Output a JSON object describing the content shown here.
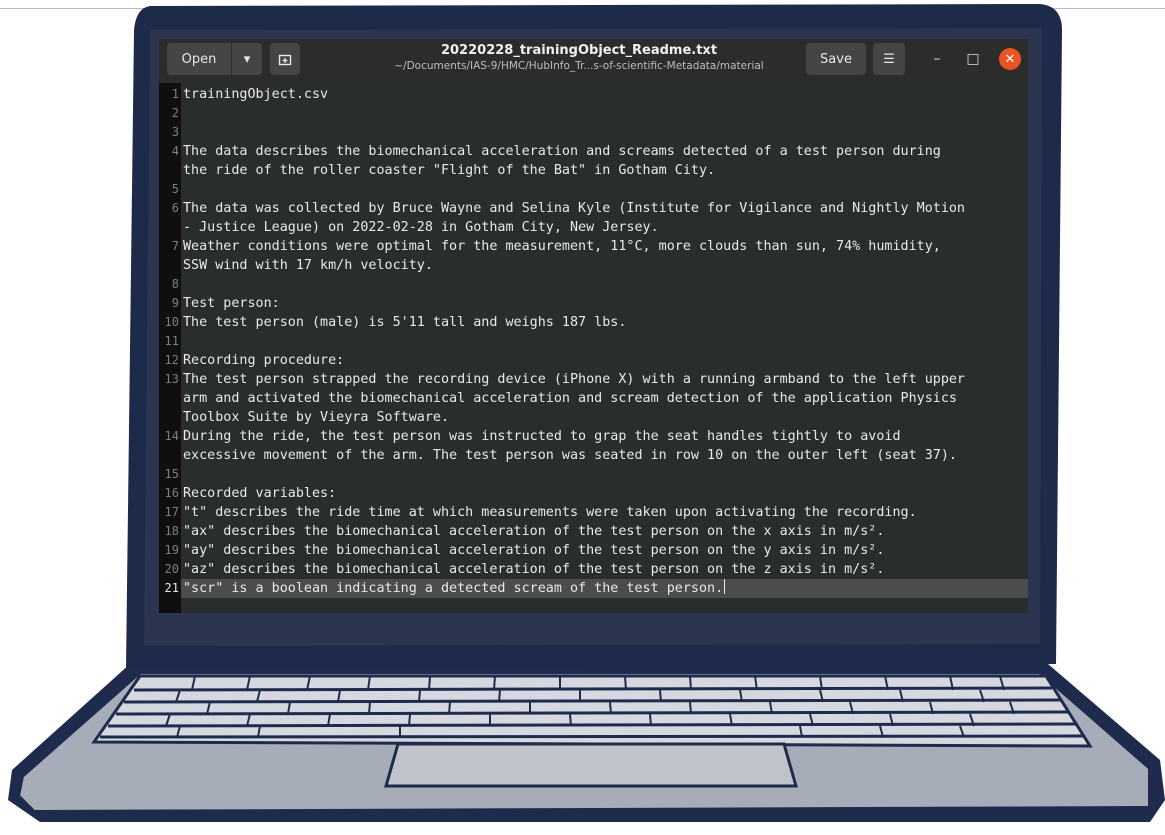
{
  "app": {
    "title": "20220228_trainingObject_Readme.txt",
    "path": "~/Documents/IAS-9/HMC/HubInfo_Tr...s-of-scientific-Metadata/material"
  },
  "toolbar": {
    "open_label": "Open",
    "open_menu_icon": "chevron-down-icon",
    "new_tab_icon": "new-tab-icon",
    "save_label": "Save",
    "menu_icon": "hamburger-menu-icon"
  },
  "window_controls": {
    "minimize": "–",
    "maximize": "□",
    "close": "✕"
  },
  "editor": {
    "current_line": 21,
    "lines": [
      {
        "n": "1",
        "text": "trainingObject.csv"
      },
      {
        "n": "2",
        "text": ""
      },
      {
        "n": "3",
        "text": ""
      },
      {
        "n": "4",
        "text": "The data describes the biomechanical acceleration and screams detected of a test person during\nthe ride of the roller coaster \"Flight of the Bat\" in Gotham City."
      },
      {
        "n": "5",
        "text": ""
      },
      {
        "n": "6",
        "text": "The data was collected by Bruce Wayne and Selina Kyle (Institute for Vigilance and Nightly Motion\n- Justice League) on 2022-02-28 in Gotham City, New Jersey."
      },
      {
        "n": "7",
        "text": "Weather conditions were optimal for the measurement, 11°C, more clouds than sun, 74% humidity,\nSSW wind with 17 km/h velocity."
      },
      {
        "n": "8",
        "text": ""
      },
      {
        "n": "9",
        "text": "Test person:"
      },
      {
        "n": "10",
        "text": "The test person (male) is 5'11 tall and weighs 187 lbs."
      },
      {
        "n": "11",
        "text": ""
      },
      {
        "n": "12",
        "text": "Recording procedure:"
      },
      {
        "n": "13",
        "text": "The test person strapped the recording device (iPhone X) with a running armband to the left upper\narm and activated the biomechanical acceleration and scream detection of the application Physics\nToolbox Suite by Vieyra Software."
      },
      {
        "n": "14",
        "text": "During the ride, the test person was instructed to grap the seat handles tightly to avoid\nexcessive movement of the arm. The test person was seated in row 10 on the outer left (seat 37)."
      },
      {
        "n": "15",
        "text": ""
      },
      {
        "n": "16",
        "text": "Recorded variables:"
      },
      {
        "n": "17",
        "text": "\"t\" describes the ride time at which measurements were taken upon activating the recording."
      },
      {
        "n": "18",
        "text": "\"ax\" describes the biomechanical acceleration of the test person on the x axis in m/s²."
      },
      {
        "n": "19",
        "text": "\"ay\" describes the biomechanical acceleration of the test person on the y axis in m/s²."
      },
      {
        "n": "20",
        "text": "\"az\" describes the biomechanical acceleration of the test person on the z axis in m/s²."
      },
      {
        "n": "21",
        "text": "\"scr\" is a boolean indicating a detected scream of the test person."
      }
    ]
  },
  "colors": {
    "accent_close": "#e95420",
    "laptop_frame": "#1e2a4a",
    "laptop_base": "#9aa1ad",
    "editor_bg": "#2a2d2e"
  }
}
